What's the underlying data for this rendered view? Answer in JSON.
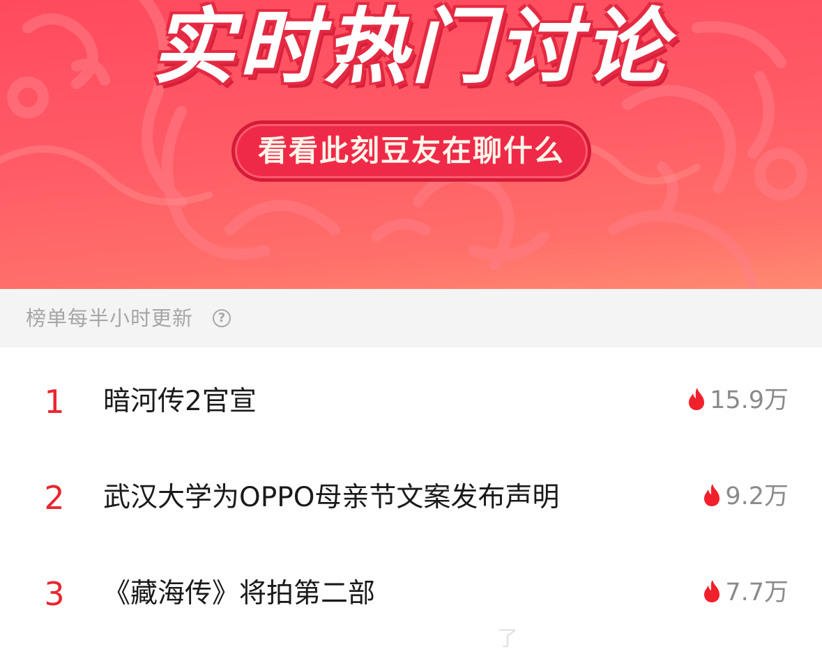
{
  "banner": {
    "title": "实时热门讨论",
    "subtitle": "看看此刻豆友在聊什么"
  },
  "update": {
    "text": "榜单每半小时更新",
    "help_glyph": "?"
  },
  "list": {
    "items": [
      {
        "rank": "1",
        "title": "暗河传2官宣",
        "heat": "15.9万"
      },
      {
        "rank": "2",
        "title": "武汉大学为OPPO母亲节文案发布声明",
        "heat": "9.2万"
      },
      {
        "rank": "3",
        "title": "《藏海传》将拍第二部",
        "heat": "7.7万"
      }
    ]
  },
  "watermark": {
    "text": "了"
  },
  "colors": {
    "banner_red": "#ff4a5e",
    "rank_red": "#e8262f",
    "fire_red": "#f0202c",
    "strip_gray": "#f4f4f4"
  }
}
